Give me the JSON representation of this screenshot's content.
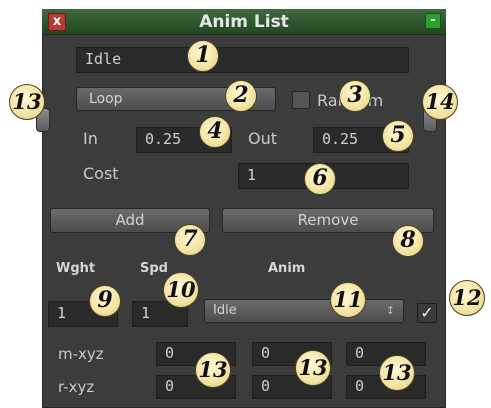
{
  "window": {
    "title": "Anim List",
    "close_label": "x",
    "minimize_label": "-"
  },
  "anim": {
    "name_value": "Idle",
    "mode_value": "Loop",
    "random_label": "Random",
    "in_label": "In",
    "in_value": "0.25",
    "out_label": "Out",
    "out_value": "0.25",
    "cost_label": "Cost",
    "cost_value": "1",
    "add_label": "Add",
    "remove_label": "Remove"
  },
  "table": {
    "headers": {
      "weight": "Wght",
      "speed": "Spd",
      "anim": "Anim"
    },
    "row": {
      "weight": "1",
      "speed": "1",
      "anim": "Idle",
      "enabled": true,
      "check_glyph": "✓"
    },
    "m_xyz_label": "m-xyz",
    "m_xyz": [
      "0",
      "0",
      "0"
    ],
    "r_xyz_label": "r-xyz",
    "r_xyz": [
      "0",
      "0",
      "0"
    ]
  },
  "callouts": [
    "1",
    "2",
    "3",
    "4",
    "5",
    "6",
    "7",
    "8",
    "9",
    "10",
    "11",
    "12",
    "13",
    "13",
    "13",
    "13",
    "14"
  ]
}
